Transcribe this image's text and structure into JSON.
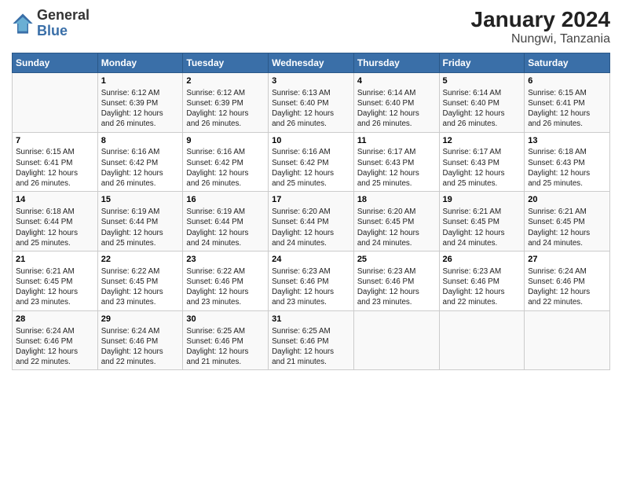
{
  "header": {
    "logo_line1": "General",
    "logo_line2": "Blue",
    "title": "January 2024",
    "subtitle": "Nungwi, Tanzania"
  },
  "days_of_week": [
    "Sunday",
    "Monday",
    "Tuesday",
    "Wednesday",
    "Thursday",
    "Friday",
    "Saturday"
  ],
  "weeks": [
    [
      {
        "day": "",
        "info": ""
      },
      {
        "day": "1",
        "info": "Sunrise: 6:12 AM\nSunset: 6:39 PM\nDaylight: 12 hours\nand 26 minutes."
      },
      {
        "day": "2",
        "info": "Sunrise: 6:12 AM\nSunset: 6:39 PM\nDaylight: 12 hours\nand 26 minutes."
      },
      {
        "day": "3",
        "info": "Sunrise: 6:13 AM\nSunset: 6:40 PM\nDaylight: 12 hours\nand 26 minutes."
      },
      {
        "day": "4",
        "info": "Sunrise: 6:14 AM\nSunset: 6:40 PM\nDaylight: 12 hours\nand 26 minutes."
      },
      {
        "day": "5",
        "info": "Sunrise: 6:14 AM\nSunset: 6:40 PM\nDaylight: 12 hours\nand 26 minutes."
      },
      {
        "day": "6",
        "info": "Sunrise: 6:15 AM\nSunset: 6:41 PM\nDaylight: 12 hours\nand 26 minutes."
      }
    ],
    [
      {
        "day": "7",
        "info": "Sunrise: 6:15 AM\nSunset: 6:41 PM\nDaylight: 12 hours\nand 26 minutes."
      },
      {
        "day": "8",
        "info": "Sunrise: 6:16 AM\nSunset: 6:42 PM\nDaylight: 12 hours\nand 26 minutes."
      },
      {
        "day": "9",
        "info": "Sunrise: 6:16 AM\nSunset: 6:42 PM\nDaylight: 12 hours\nand 26 minutes."
      },
      {
        "day": "10",
        "info": "Sunrise: 6:16 AM\nSunset: 6:42 PM\nDaylight: 12 hours\nand 25 minutes."
      },
      {
        "day": "11",
        "info": "Sunrise: 6:17 AM\nSunset: 6:43 PM\nDaylight: 12 hours\nand 25 minutes."
      },
      {
        "day": "12",
        "info": "Sunrise: 6:17 AM\nSunset: 6:43 PM\nDaylight: 12 hours\nand 25 minutes."
      },
      {
        "day": "13",
        "info": "Sunrise: 6:18 AM\nSunset: 6:43 PM\nDaylight: 12 hours\nand 25 minutes."
      }
    ],
    [
      {
        "day": "14",
        "info": "Sunrise: 6:18 AM\nSunset: 6:44 PM\nDaylight: 12 hours\nand 25 minutes."
      },
      {
        "day": "15",
        "info": "Sunrise: 6:19 AM\nSunset: 6:44 PM\nDaylight: 12 hours\nand 25 minutes."
      },
      {
        "day": "16",
        "info": "Sunrise: 6:19 AM\nSunset: 6:44 PM\nDaylight: 12 hours\nand 24 minutes."
      },
      {
        "day": "17",
        "info": "Sunrise: 6:20 AM\nSunset: 6:44 PM\nDaylight: 12 hours\nand 24 minutes."
      },
      {
        "day": "18",
        "info": "Sunrise: 6:20 AM\nSunset: 6:45 PM\nDaylight: 12 hours\nand 24 minutes."
      },
      {
        "day": "19",
        "info": "Sunrise: 6:21 AM\nSunset: 6:45 PM\nDaylight: 12 hours\nand 24 minutes."
      },
      {
        "day": "20",
        "info": "Sunrise: 6:21 AM\nSunset: 6:45 PM\nDaylight: 12 hours\nand 24 minutes."
      }
    ],
    [
      {
        "day": "21",
        "info": "Sunrise: 6:21 AM\nSunset: 6:45 PM\nDaylight: 12 hours\nand 23 minutes."
      },
      {
        "day": "22",
        "info": "Sunrise: 6:22 AM\nSunset: 6:45 PM\nDaylight: 12 hours\nand 23 minutes."
      },
      {
        "day": "23",
        "info": "Sunrise: 6:22 AM\nSunset: 6:46 PM\nDaylight: 12 hours\nand 23 minutes."
      },
      {
        "day": "24",
        "info": "Sunrise: 6:23 AM\nSunset: 6:46 PM\nDaylight: 12 hours\nand 23 minutes."
      },
      {
        "day": "25",
        "info": "Sunrise: 6:23 AM\nSunset: 6:46 PM\nDaylight: 12 hours\nand 23 minutes."
      },
      {
        "day": "26",
        "info": "Sunrise: 6:23 AM\nSunset: 6:46 PM\nDaylight: 12 hours\nand 22 minutes."
      },
      {
        "day": "27",
        "info": "Sunrise: 6:24 AM\nSunset: 6:46 PM\nDaylight: 12 hours\nand 22 minutes."
      }
    ],
    [
      {
        "day": "28",
        "info": "Sunrise: 6:24 AM\nSunset: 6:46 PM\nDaylight: 12 hours\nand 22 minutes."
      },
      {
        "day": "29",
        "info": "Sunrise: 6:24 AM\nSunset: 6:46 PM\nDaylight: 12 hours\nand 22 minutes."
      },
      {
        "day": "30",
        "info": "Sunrise: 6:25 AM\nSunset: 6:46 PM\nDaylight: 12 hours\nand 21 minutes."
      },
      {
        "day": "31",
        "info": "Sunrise: 6:25 AM\nSunset: 6:46 PM\nDaylight: 12 hours\nand 21 minutes."
      },
      {
        "day": "",
        "info": ""
      },
      {
        "day": "",
        "info": ""
      },
      {
        "day": "",
        "info": ""
      }
    ]
  ]
}
